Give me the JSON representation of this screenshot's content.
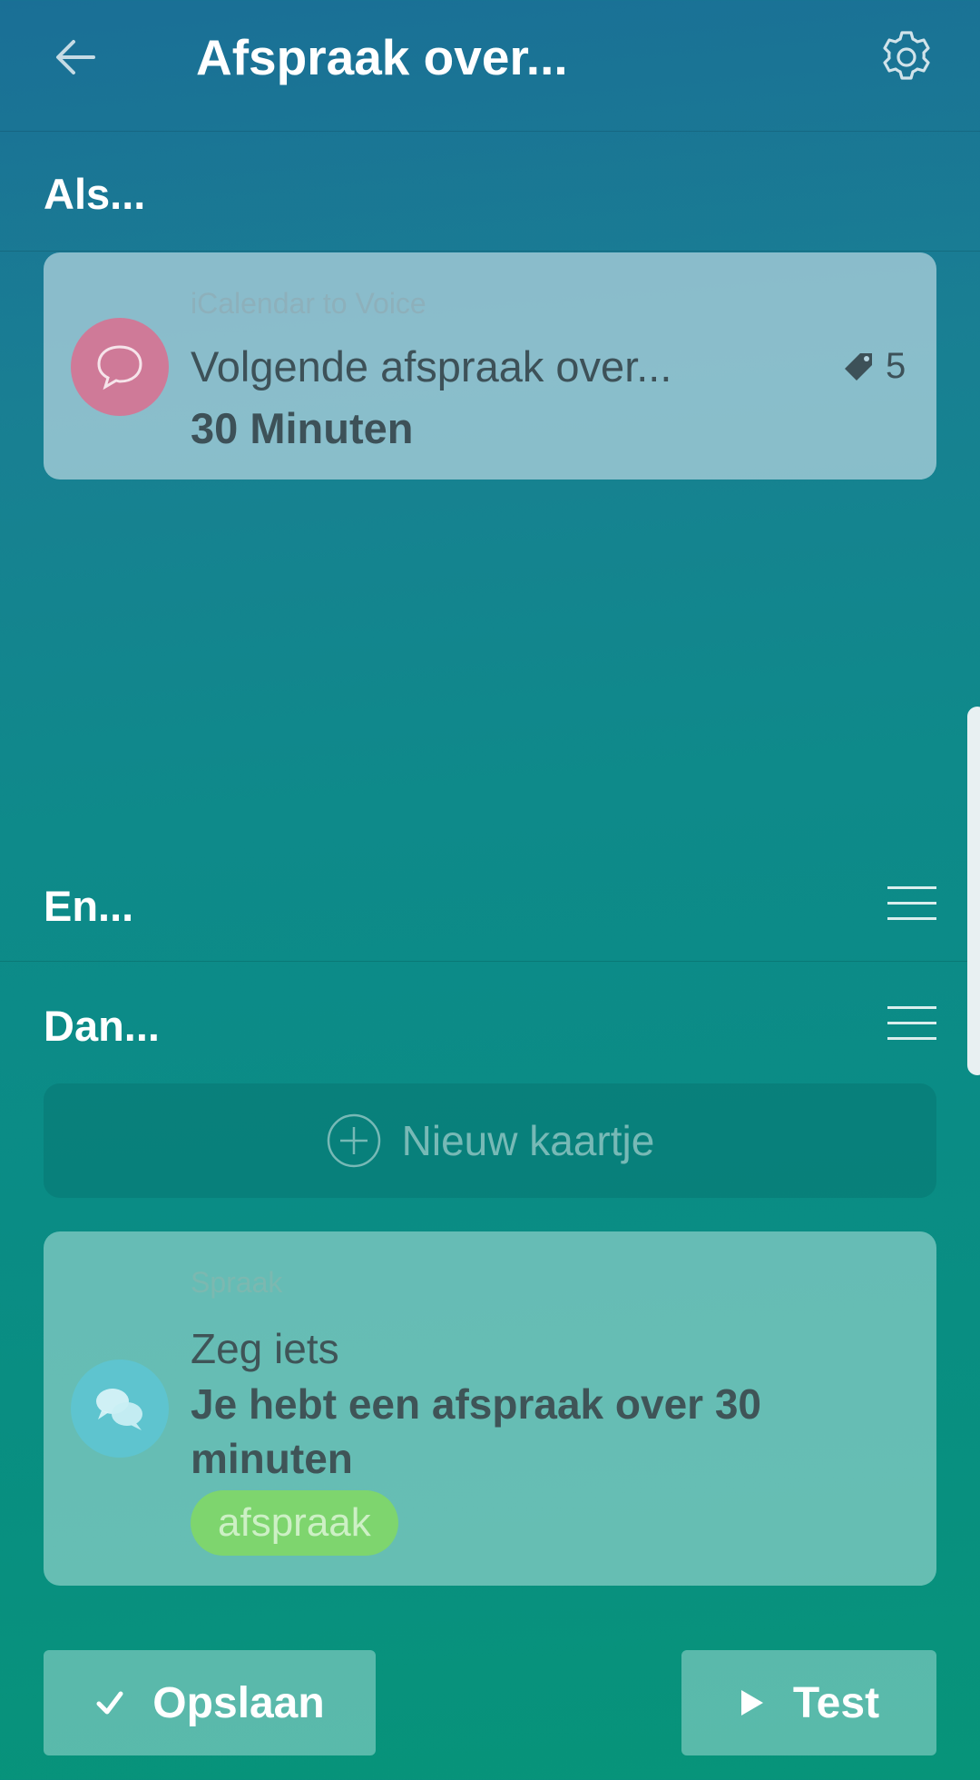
{
  "header": {
    "title": "Afspraak over...",
    "back_icon": "arrow-left-icon",
    "settings_icon": "gear-icon"
  },
  "sections": {
    "if_label": "Als...",
    "and_label": "En...",
    "then_label": "Dan..."
  },
  "trigger_card": {
    "source": "iCalendar to Voice",
    "text_main": "Volgende afspraak over...",
    "text_bold": "30 Minuten",
    "tag_count": "5",
    "icon": "speech-bubble-icon",
    "icon_color": "#cf7a98"
  },
  "new_card": {
    "label": "Nieuw kaartje",
    "icon": "plus-circle-icon"
  },
  "action_card": {
    "source": "Spraak",
    "title": "Zeg iets",
    "text": "Je hebt een afspraak over 30 minuten",
    "tag": "afspraak",
    "icon": "chat-bubbles-icon",
    "icon_color": "#5ec4cf",
    "tag_color": "#7ed56e"
  },
  "buttons": {
    "save": "Opslaan",
    "test": "Test"
  }
}
